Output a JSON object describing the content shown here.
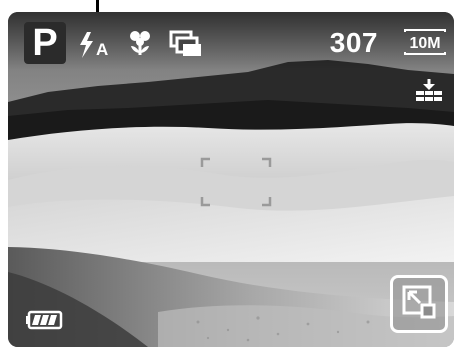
{
  "camera": {
    "mode": "P",
    "flash_mode_label": "A",
    "shots_remaining": "307",
    "image_size": "10M",
    "icons": {
      "flash": "flash-auto-icon",
      "macro": "macro-flower-icon",
      "drive": "continuous-shot-icon",
      "quality": "quality-stack-icon",
      "focus": "focus-bracket-icon",
      "battery": "battery-full-icon",
      "expand": "expand-arrow-icon"
    },
    "battery_level": 1.0
  }
}
